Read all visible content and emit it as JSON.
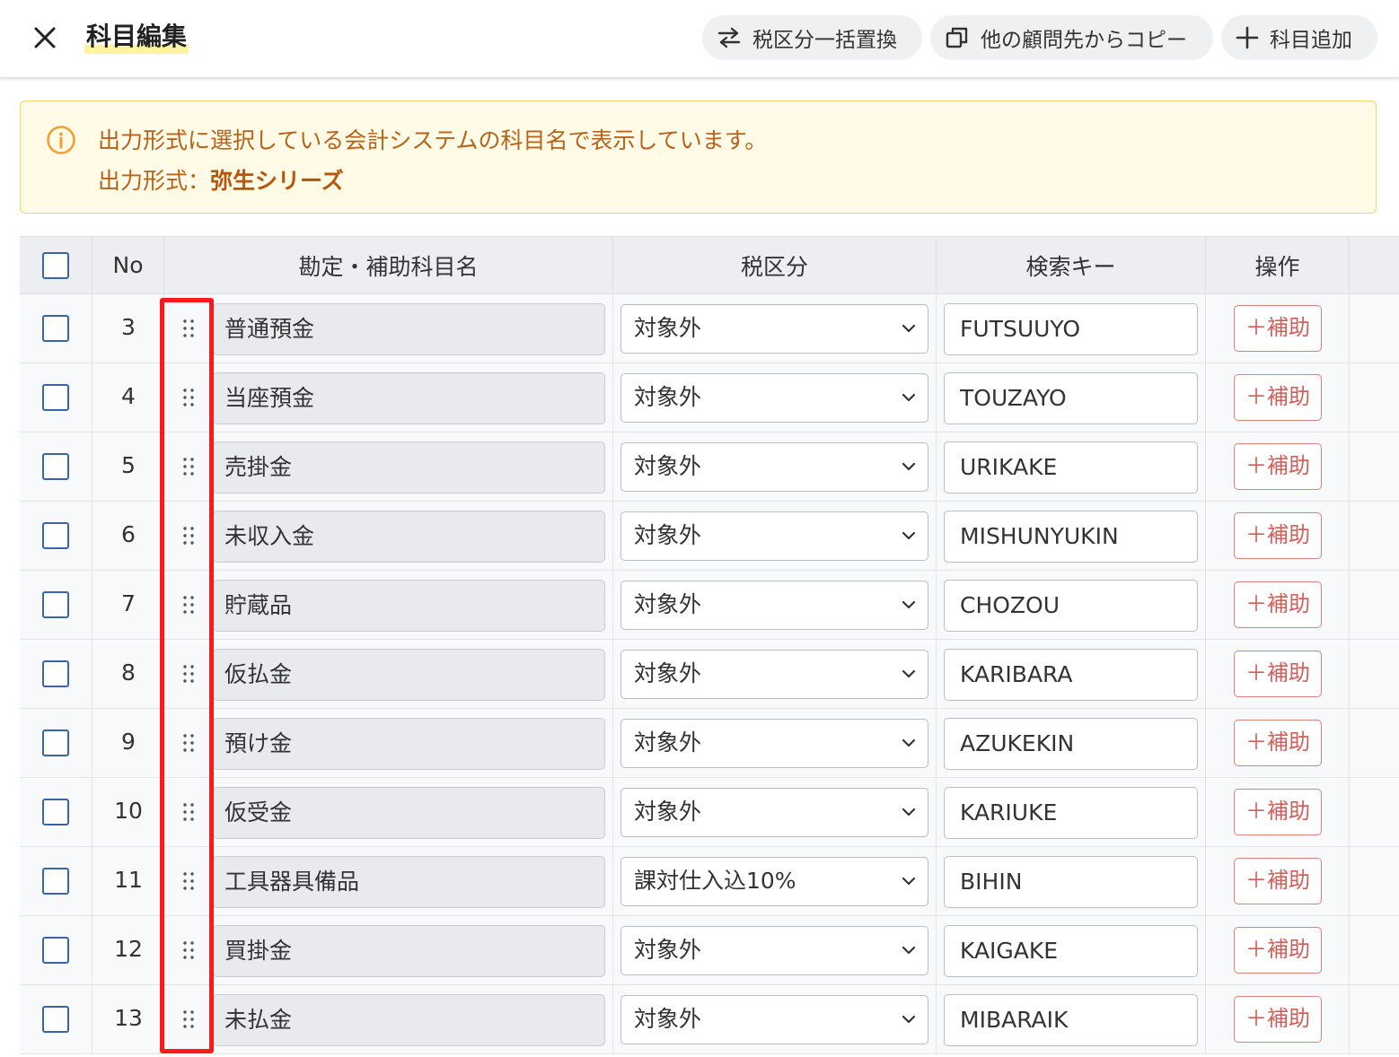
{
  "header": {
    "title": "科目編集",
    "buttons": {
      "tax_replace": "税区分一括置換",
      "copy_from_client": "他の顧問先からコピー",
      "add_account": "科目追加"
    }
  },
  "banner": {
    "line1": "出力形式に選択している会計システムの科目名で表示しています。",
    "format_label": "出力形式：",
    "format_value": "弥生シリーズ",
    "color": "#b8621a"
  },
  "table": {
    "columns": {
      "no": "No",
      "name": "勘定・補助科目名",
      "tax": "税区分",
      "key": "検索キー",
      "ops": "操作"
    },
    "sub_label": "＋補助",
    "rows": [
      {
        "no": "3",
        "name": "普通預金",
        "tax": "対象外",
        "key": "FUTSUUYO"
      },
      {
        "no": "4",
        "name": "当座預金",
        "tax": "対象外",
        "key": "TOUZAYO"
      },
      {
        "no": "5",
        "name": "売掛金",
        "tax": "対象外",
        "key": "URIKAKE"
      },
      {
        "no": "6",
        "name": "未収入金",
        "tax": "対象外",
        "key": "MISHUNYUKIN"
      },
      {
        "no": "7",
        "name": "貯蔵品",
        "tax": "対象外",
        "key": "CHOZOU"
      },
      {
        "no": "8",
        "name": "仮払金",
        "tax": "対象外",
        "key": "KARIBARA"
      },
      {
        "no": "9",
        "name": "預け金",
        "tax": "対象外",
        "key": "AZUKEKIN"
      },
      {
        "no": "10",
        "name": "仮受金",
        "tax": "対象外",
        "key": "KARIUKE"
      },
      {
        "no": "11",
        "name": "工具器具備品",
        "tax": "課対仕入込10%",
        "key": "BIHIN"
      },
      {
        "no": "12",
        "name": "買掛金",
        "tax": "対象外",
        "key": "KAIGAKE"
      },
      {
        "no": "13",
        "name": "未払金",
        "tax": "対象外",
        "key": "MIBARAIK"
      }
    ]
  },
  "colors": {
    "accent_highlight": "#ff1a1a",
    "checkbox": "#3a63a8",
    "sub_button": "#d0605c"
  }
}
